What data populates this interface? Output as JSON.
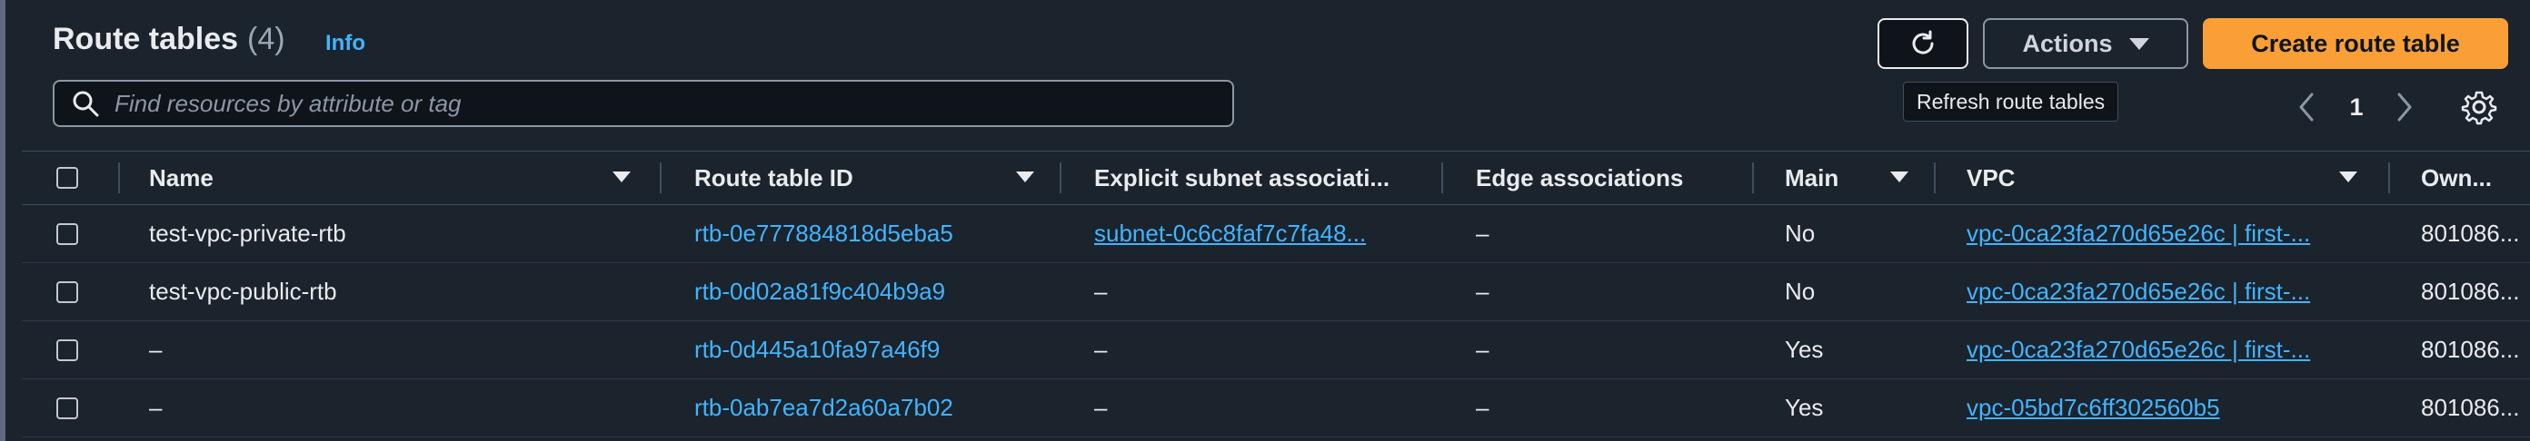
{
  "header": {
    "title": "Route tables",
    "count": "(4)",
    "info_label": "Info"
  },
  "search": {
    "placeholder": "Find resources by attribute or tag"
  },
  "toolbar": {
    "actions_label": "Actions",
    "create_label": "Create route table",
    "refresh_tooltip": "Refresh route tables"
  },
  "pagination": {
    "current_page": "1"
  },
  "table": {
    "columns": [
      "Name",
      "Route table ID",
      "Explicit subnet associati...",
      "Edge associations",
      "Main",
      "VPC",
      "Own..."
    ],
    "rows": [
      {
        "name": "test-vpc-private-rtb",
        "route_table_id": "rtb-0e777884818d5eba5",
        "subnet": "subnet-0c6c8faf7c7fa48...",
        "edge": "–",
        "main": "No",
        "vpc": "vpc-0ca23fa270d65e26c | first-...",
        "owner": "801086..."
      },
      {
        "name": "test-vpc-public-rtb",
        "route_table_id": "rtb-0d02a81f9c404b9a9",
        "subnet": "–",
        "edge": "–",
        "main": "No",
        "vpc": "vpc-0ca23fa270d65e26c | first-...",
        "owner": "801086..."
      },
      {
        "name": "–",
        "route_table_id": "rtb-0d445a10fa97a46f9",
        "subnet": "–",
        "edge": "–",
        "main": "Yes",
        "vpc": "vpc-0ca23fa270d65e26c | first-...",
        "owner": "801086..."
      },
      {
        "name": "–",
        "route_table_id": "rtb-0ab7ea7d2a60a7b02",
        "subnet": "–",
        "edge": "–",
        "main": "Yes",
        "vpc": "vpc-05bd7c6ff302560b5",
        "owner": "801086..."
      }
    ]
  },
  "colors": {
    "background": "#1b232d",
    "link": "#42b4ff",
    "primary_button": "#f99f36",
    "text": "#e9ebed"
  }
}
